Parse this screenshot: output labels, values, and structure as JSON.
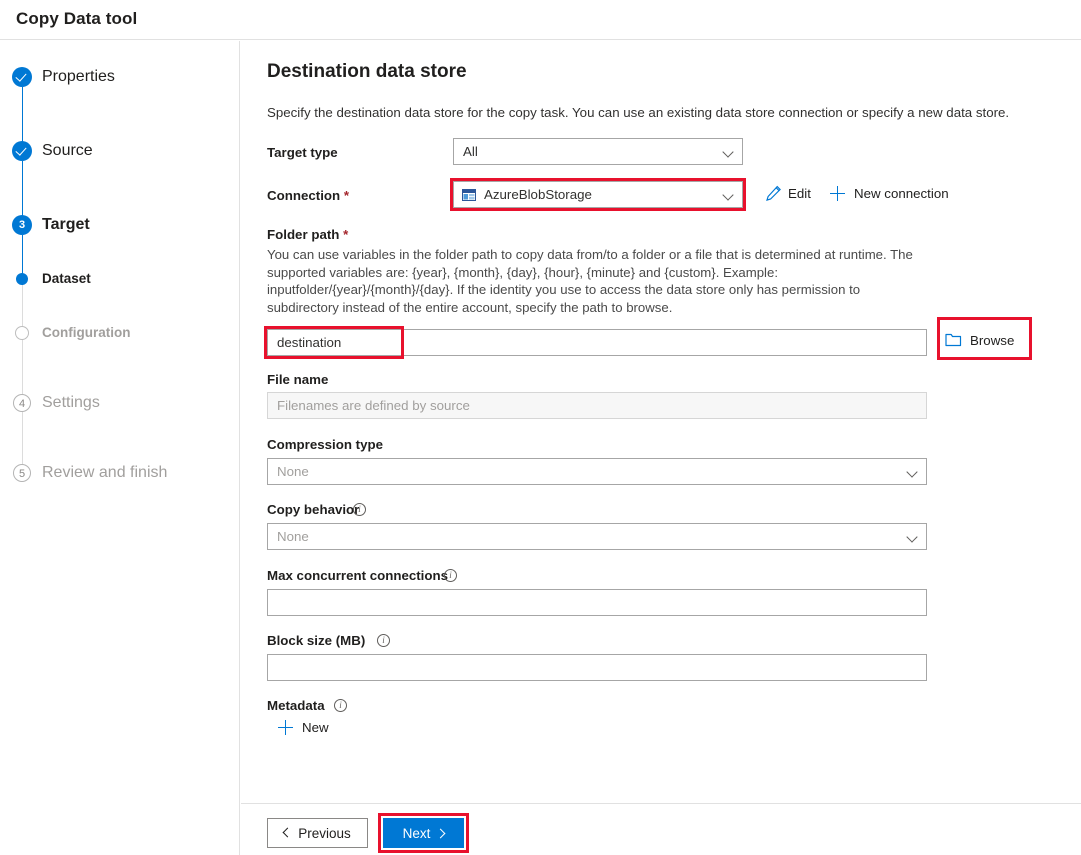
{
  "window": {
    "title": "Copy Data tool"
  },
  "sidebar": {
    "steps": [
      {
        "label": "Properties",
        "state": "done",
        "marker": "check"
      },
      {
        "label": "Source",
        "state": "done",
        "marker": "check"
      },
      {
        "label": "Target",
        "state": "current",
        "marker": "3"
      },
      {
        "label": "Dataset",
        "state": "substep",
        "marker": "dot"
      },
      {
        "label": "Configuration",
        "state": "pending",
        "marker": "hollow"
      },
      {
        "label": "Settings",
        "state": "pending",
        "marker": "4"
      },
      {
        "label": "Review and finish",
        "state": "pending",
        "marker": "5"
      }
    ]
  },
  "main": {
    "title": "Destination data store",
    "description": "Specify the destination data store for the copy task. You can use an existing data store connection or specify a new data store.",
    "target_type": {
      "label": "Target type",
      "value": "All"
    },
    "connection": {
      "label": "Connection",
      "required_mark": "*",
      "value": "AzureBlobStorage",
      "icon": "azure-blob-storage-icon",
      "edit_label": "Edit",
      "new_connection_label": "New connection"
    },
    "folder_path": {
      "label": "Folder path",
      "required_mark": "*",
      "help": "You can use variables in the folder path to copy data from/to a folder or a file that is determined at runtime. The supported variables are: {year}, {month}, {day}, {hour}, {minute} and {custom}. Example: inputfolder/{year}/{month}/{day}. If the identity you use to access the data store only has permission to subdirectory instead of the entire account, specify the path to browse.",
      "value": "destination",
      "browse_label": "Browse"
    },
    "file_name": {
      "label": "File name",
      "value": "",
      "placeholder": "Filenames are defined by source"
    },
    "compression_type": {
      "label": "Compression type",
      "value": "None"
    },
    "copy_behavior": {
      "label": "Copy behavior",
      "value": "None",
      "has_info": true
    },
    "max_concurrent_connections": {
      "label": "Max concurrent connections",
      "value": "",
      "has_info": true
    },
    "block_size": {
      "label": "Block size (MB)",
      "value": "",
      "has_info": true
    },
    "metadata": {
      "label": "Metadata",
      "has_info": true,
      "new_label": "New"
    }
  },
  "footer": {
    "previous_label": "Previous",
    "next_label": "Next"
  },
  "colors": {
    "accent": "#0078d4",
    "highlight": "#e8112d",
    "required": "#a4262c",
    "muted_text": "#a19f9d"
  }
}
